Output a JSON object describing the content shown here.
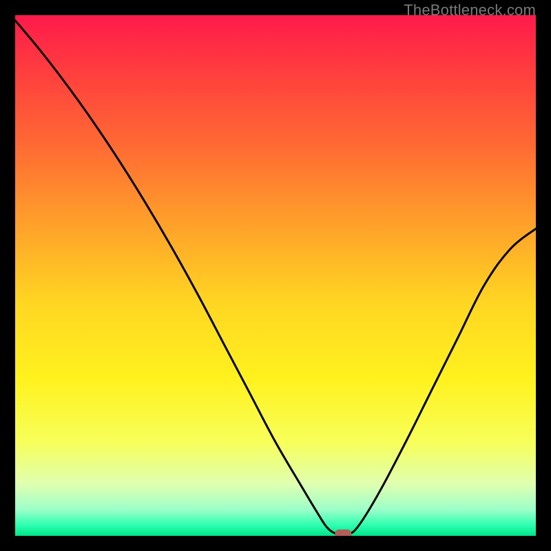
{
  "watermark": "TheBottleneck.com",
  "chart_data": {
    "type": "line",
    "title": "",
    "xlabel": "",
    "ylabel": "",
    "xlim": [
      0,
      100
    ],
    "ylim": [
      0,
      100
    ],
    "series": [
      {
        "name": "curve",
        "x": [
          0,
          5,
          10,
          15,
          20,
          25,
          30,
          35,
          40,
          45,
          50,
          55,
          58,
          60,
          62,
          64,
          66,
          70,
          75,
          80,
          85,
          90,
          95,
          100
        ],
        "y": [
          99,
          93,
          86.5,
          79.5,
          72,
          64,
          55.5,
          46.5,
          37,
          27.5,
          18,
          9.5,
          4.5,
          1.5,
          0.3,
          0.3,
          2,
          8.5,
          18,
          28,
          38,
          48,
          55,
          59
        ]
      }
    ],
    "marker": {
      "x": 63,
      "y": 0.3,
      "color": "#b06058"
    },
    "gradient_stops": [
      {
        "offset": 0.0,
        "color": "#ff1a4b"
      },
      {
        "offset": 0.1,
        "color": "#ff3b3f"
      },
      {
        "offset": 0.25,
        "color": "#ff6a33"
      },
      {
        "offset": 0.4,
        "color": "#ffa02a"
      },
      {
        "offset": 0.55,
        "color": "#ffd522"
      },
      {
        "offset": 0.7,
        "color": "#fff21e"
      },
      {
        "offset": 0.82,
        "color": "#f7ff5a"
      },
      {
        "offset": 0.9,
        "color": "#e0ffb0"
      },
      {
        "offset": 0.95,
        "color": "#9cffc9"
      },
      {
        "offset": 0.98,
        "color": "#2bffb0"
      },
      {
        "offset": 1.0,
        "color": "#00e38a"
      }
    ]
  }
}
